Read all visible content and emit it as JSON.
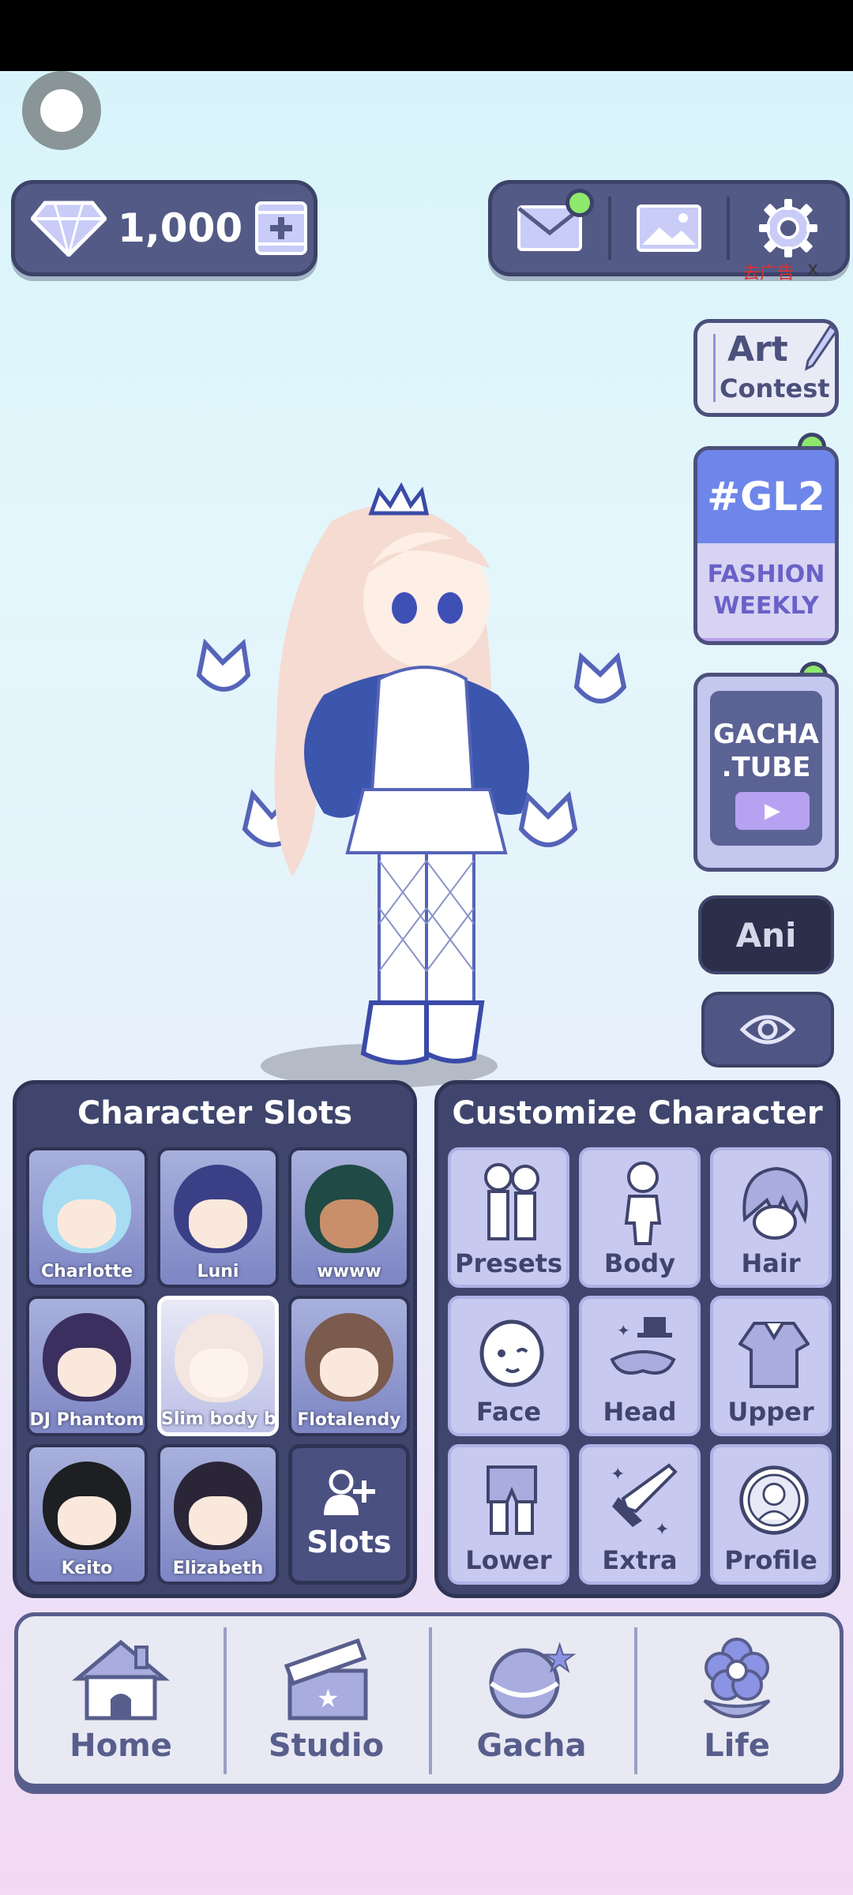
{
  "currency": {
    "amount": "1,000",
    "icon": "diamond-icon"
  },
  "toolbar": {
    "mail_icon": "mail-icon",
    "gallery_icon": "image-icon",
    "settings_icon": "gear-icon"
  },
  "ad": {
    "label": "去广告",
    "close": "x"
  },
  "side_buttons": {
    "art_contest": {
      "line1": "Art",
      "line2": "Contest"
    },
    "gl2": {
      "title": "#GL2",
      "line1": "FASHION",
      "line2": "WEEKLY"
    },
    "gachatube": {
      "line1": "GACHA",
      "line2": ".TUBE"
    },
    "ani": "Ani"
  },
  "slots": {
    "title": "Character Slots",
    "items": [
      {
        "name": "Charlotte",
        "hair": "#a7dcf3"
      },
      {
        "name": "Luni",
        "hair": "#3b3f86"
      },
      {
        "name": "wwww",
        "hair": "#1f4a45"
      },
      {
        "name": "DJ Phantom",
        "hair": "#3a2f5e"
      },
      {
        "name": "Slim body bas",
        "hair": "#f3e6e0"
      },
      {
        "name": "Flotalendy",
        "hair": "#7a5b4d"
      },
      {
        "name": "Keito",
        "hair": "#1d1f22"
      },
      {
        "name": "Elizabeth",
        "hair": "#2b2538"
      }
    ],
    "add_label": "Slots"
  },
  "customize": {
    "title": "Customize Character",
    "items": [
      {
        "label": "Presets",
        "icon": "presets-icon"
      },
      {
        "label": "Body",
        "icon": "body-icon"
      },
      {
        "label": "Hair",
        "icon": "hair-icon"
      },
      {
        "label": "Face",
        "icon": "face-icon"
      },
      {
        "label": "Head",
        "icon": "head-icon"
      },
      {
        "label": "Upper",
        "icon": "upper-icon"
      },
      {
        "label": "Lower",
        "icon": "lower-icon"
      },
      {
        "label": "Extra",
        "icon": "extra-icon"
      },
      {
        "label": "Profile",
        "icon": "profile-icon"
      }
    ]
  },
  "nav": {
    "items": [
      {
        "label": "Home",
        "icon": "home-icon"
      },
      {
        "label": "Studio",
        "icon": "clapperboard-icon"
      },
      {
        "label": "Gacha",
        "icon": "gacha-icon"
      },
      {
        "label": "Life",
        "icon": "flower-icon"
      }
    ]
  }
}
